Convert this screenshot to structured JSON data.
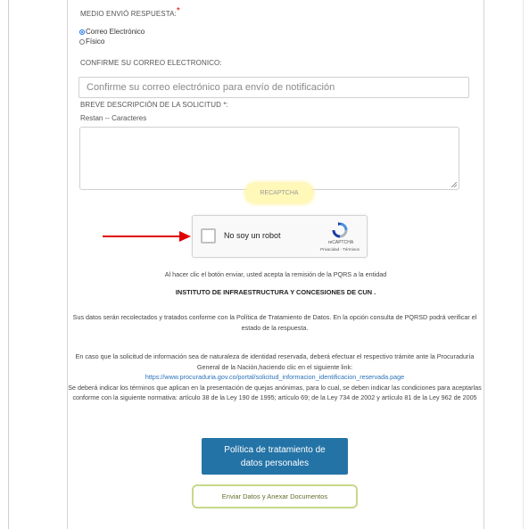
{
  "form": {
    "medio_label": "MEDIO ENVIÓ RESPUESTA:",
    "required_mark": "*",
    "options": [
      {
        "label": "Correo Electrónico",
        "checked": true
      },
      {
        "label": "Físico",
        "checked": false
      }
    ],
    "confirm_label": "CONFIRME SU CORREO ELECTRONICO:",
    "confirm_placeholder": "Confirme su correo electrónico para envío de notificación",
    "description_label": "BREVE DESCRIPCIÓN DE LA SOLICITUD *:",
    "remaining_text": "Restan -- Caracteres"
  },
  "recaptcha": {
    "pill_label": "reCAPTCHA",
    "checkbox_label": "No soy un robot",
    "brand": "reCAPTCHA",
    "links": "Privacidad - Términos"
  },
  "notice": {
    "accept_text": "Al hacer clic el botón enviar, usted acepta la remisión de la PQRS a la entidad",
    "institute": "INSTITUTO DE INFRAESTRUCTURA Y CONCESIONES DE CUN .",
    "data_policy": "Sus datos serán recolectados y tratados conforme con la Política de Tratamiento de Datos. En la opción consulta de PQRSD podrá verificar el estado de la respuesta.",
    "reserved_text": "En caso que la solicitud de información sea de naturaleza de identidad reservada, deberá efectuar el respectivo trámite ante la Procuraduría General de la Nación,haciendo clic en el siguiente link:",
    "reserved_link": "https://www.procuraduria.gov.co/portal/solicitud_informacion_identificacion_reservada.page",
    "anon_text": "Se deberá indicar los términos que aplican en la presentación de quejas anónimas, para lo cual, se deben indicar las condiciones para aceptarlas conforme con la siguiente normativa: artículo 38 de la Ley 190 de 1995; artículo 69; de la Ley 734 de 2002 y artículo 81 de la Ley 962 de 2005"
  },
  "buttons": {
    "policy_label": "Política de tratamiento de datos personales",
    "submit_label": "Enviar Datos y Anexar Documentos"
  },
  "colors": {
    "primary_button": "#2473a6",
    "outline_button_border": "#c7d98a",
    "arrow": "#e00000",
    "link": "#2a72b8",
    "required": "#e00000"
  }
}
